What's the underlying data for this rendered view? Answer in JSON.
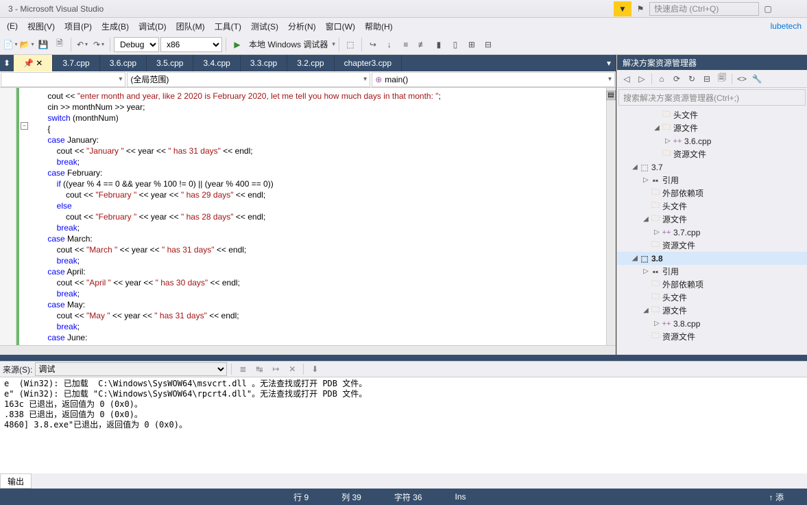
{
  "titlebar": {
    "title": "3 - Microsoft Visual Studio",
    "quicklaunch_placeholder": "快速启动 (Ctrl+Q)",
    "user": "lubetech"
  },
  "menu": {
    "items": [
      "(E)",
      "视图(V)",
      "项目(P)",
      "生成(B)",
      "调试(D)",
      "团队(M)",
      "工具(T)",
      "测试(S)",
      "分析(N)",
      "窗口(W)",
      "帮助(H)"
    ]
  },
  "toolbar": {
    "config": "Debug",
    "platform": "x86",
    "debugger": "本地 Windows 调试器"
  },
  "tabs": [
    {
      "label": "3.7.cpp",
      "active": false
    },
    {
      "label": "3.6.cpp",
      "active": false
    },
    {
      "label": "3.5.cpp",
      "active": false
    },
    {
      "label": "3.4.cpp",
      "active": false
    },
    {
      "label": "3.3.cpp",
      "active": false
    },
    {
      "label": "3.2.cpp",
      "active": false
    },
    {
      "label": "chapter3.cpp",
      "active": false
    }
  ],
  "activeTab": "",
  "navbar": {
    "scope": "(全局范围)",
    "func": "main()"
  },
  "code_lines": [
    {
      "indent": 1,
      "t": [
        {
          "k": "p",
          "v": "cout << "
        },
        {
          "k": "s",
          "v": "\"enter month and year, like 2 2020 is February 2020, let me tell you how much days in that month: \""
        },
        {
          "k": "p",
          "v": ";"
        }
      ]
    },
    {
      "indent": 1,
      "t": [
        {
          "k": "p",
          "v": "cin >> monthNum >> year;"
        }
      ]
    },
    {
      "indent": 1,
      "t": [
        {
          "k": "k",
          "v": "switch"
        },
        {
          "k": "p",
          "v": " (monthNum)"
        }
      ]
    },
    {
      "indent": 1,
      "t": [
        {
          "k": "p",
          "v": "{"
        }
      ]
    },
    {
      "indent": 1,
      "t": [
        {
          "k": "k",
          "v": "case"
        },
        {
          "k": "p",
          "v": " January:"
        }
      ]
    },
    {
      "indent": 2,
      "t": [
        {
          "k": "p",
          "v": "cout << "
        },
        {
          "k": "s",
          "v": "\"January \""
        },
        {
          "k": "p",
          "v": " << year << "
        },
        {
          "k": "s",
          "v": "\" has 31 days\""
        },
        {
          "k": "p",
          "v": " << endl;"
        }
      ]
    },
    {
      "indent": 2,
      "t": [
        {
          "k": "k",
          "v": "break"
        },
        {
          "k": "p",
          "v": ";"
        }
      ]
    },
    {
      "indent": 1,
      "t": [
        {
          "k": "k",
          "v": "case"
        },
        {
          "k": "p",
          "v": " February:"
        }
      ]
    },
    {
      "indent": 2,
      "t": [
        {
          "k": "k",
          "v": "if"
        },
        {
          "k": "p",
          "v": " ((year % 4 == 0 && year % 100 != 0) || (year % 400 == 0))"
        }
      ]
    },
    {
      "indent": 3,
      "t": [
        {
          "k": "p",
          "v": "cout << "
        },
        {
          "k": "s",
          "v": "\"February \""
        },
        {
          "k": "p",
          "v": " << year << "
        },
        {
          "k": "s",
          "v": "\" has 29 days\""
        },
        {
          "k": "p",
          "v": " << endl;"
        }
      ]
    },
    {
      "indent": 2,
      "t": [
        {
          "k": "k",
          "v": "else"
        }
      ]
    },
    {
      "indent": 3,
      "t": [
        {
          "k": "p",
          "v": "cout << "
        },
        {
          "k": "s",
          "v": "\"February \""
        },
        {
          "k": "p",
          "v": " << year << "
        },
        {
          "k": "s",
          "v": "\" has 28 days\""
        },
        {
          "k": "p",
          "v": " << endl;"
        }
      ]
    },
    {
      "indent": 2,
      "t": [
        {
          "k": "k",
          "v": "break"
        },
        {
          "k": "p",
          "v": ";"
        }
      ]
    },
    {
      "indent": 1,
      "t": [
        {
          "k": "k",
          "v": "case"
        },
        {
          "k": "p",
          "v": " March:"
        }
      ]
    },
    {
      "indent": 2,
      "t": [
        {
          "k": "p",
          "v": "cout << "
        },
        {
          "k": "s",
          "v": "\"March \""
        },
        {
          "k": "p",
          "v": " << year << "
        },
        {
          "k": "s",
          "v": "\" has 31 days\""
        },
        {
          "k": "p",
          "v": " << endl;"
        }
      ]
    },
    {
      "indent": 2,
      "t": [
        {
          "k": "k",
          "v": "break"
        },
        {
          "k": "p",
          "v": ";"
        }
      ]
    },
    {
      "indent": 1,
      "t": [
        {
          "k": "k",
          "v": "case"
        },
        {
          "k": "p",
          "v": " April:"
        }
      ]
    },
    {
      "indent": 2,
      "t": [
        {
          "k": "p",
          "v": "cout << "
        },
        {
          "k": "s",
          "v": "\"April \""
        },
        {
          "k": "p",
          "v": " << year << "
        },
        {
          "k": "s",
          "v": "\" has 30 days\""
        },
        {
          "k": "p",
          "v": " << endl;"
        }
      ]
    },
    {
      "indent": 2,
      "t": [
        {
          "k": "k",
          "v": "break"
        },
        {
          "k": "p",
          "v": ";"
        }
      ]
    },
    {
      "indent": 1,
      "t": [
        {
          "k": "k",
          "v": "case"
        },
        {
          "k": "p",
          "v": " May:"
        }
      ]
    },
    {
      "indent": 2,
      "t": [
        {
          "k": "p",
          "v": "cout << "
        },
        {
          "k": "s",
          "v": "\"May \""
        },
        {
          "k": "p",
          "v": " << year << "
        },
        {
          "k": "s",
          "v": "\" has 31 days\""
        },
        {
          "k": "p",
          "v": " << endl;"
        }
      ]
    },
    {
      "indent": 2,
      "t": [
        {
          "k": "k",
          "v": "break"
        },
        {
          "k": "p",
          "v": ";"
        }
      ]
    },
    {
      "indent": 1,
      "t": [
        {
          "k": "k",
          "v": "case"
        },
        {
          "k": "p",
          "v": " June:"
        }
      ]
    }
  ],
  "solution": {
    "header": "解决方案资源管理器",
    "search_placeholder": "搜索解决方案资源管理器(Ctrl+;)",
    "nodes": [
      {
        "depth": 3,
        "exp": "",
        "icon": "folder",
        "label": "头文件"
      },
      {
        "depth": 3,
        "exp": "◢",
        "icon": "folder",
        "label": "源文件"
      },
      {
        "depth": 4,
        "exp": "▷",
        "icon": "cpp",
        "label": "3.6.cpp"
      },
      {
        "depth": 3,
        "exp": "",
        "icon": "folder",
        "label": "资源文件"
      },
      {
        "depth": 1,
        "exp": "◢",
        "icon": "proj",
        "label": "3.7"
      },
      {
        "depth": 2,
        "exp": "▷",
        "icon": "ref",
        "label": "引用"
      },
      {
        "depth": 2,
        "exp": "",
        "icon": "folder",
        "label": "外部依赖项"
      },
      {
        "depth": 2,
        "exp": "",
        "icon": "folder",
        "label": "头文件"
      },
      {
        "depth": 2,
        "exp": "◢",
        "icon": "folder",
        "label": "源文件"
      },
      {
        "depth": 3,
        "exp": "▷",
        "icon": "cpp",
        "label": "3.7.cpp"
      },
      {
        "depth": 2,
        "exp": "",
        "icon": "folder",
        "label": "资源文件"
      },
      {
        "depth": 1,
        "exp": "◢",
        "icon": "proj",
        "label": "3.8",
        "bold": true,
        "sel": true
      },
      {
        "depth": 2,
        "exp": "▷",
        "icon": "ref",
        "label": "引用"
      },
      {
        "depth": 2,
        "exp": "",
        "icon": "folder",
        "label": "外部依赖项"
      },
      {
        "depth": 2,
        "exp": "",
        "icon": "folder",
        "label": "头文件"
      },
      {
        "depth": 2,
        "exp": "◢",
        "icon": "folder",
        "label": "源文件"
      },
      {
        "depth": 3,
        "exp": "▷",
        "icon": "cpp",
        "label": "3.8.cpp"
      },
      {
        "depth": 2,
        "exp": "",
        "icon": "folder",
        "label": "资源文件"
      }
    ]
  },
  "output": {
    "source_label": "来源(S):",
    "source_value": "调试",
    "lines": [
      "e\" (Win32): 已加载 \"C:\\Windows\\SysWOW64\\rpcrt4.dll\"。无法查找或打开 PDB 文件。",
      "163c 已退出，返回值为 0 (0x0)。",
      ".838 已退出，返回值为 0 (0x0)。",
      "4860] 3.8.exe\"已退出，返回值为 0 (0x0)。",
      ""
    ],
    "tab": "输出"
  },
  "status": {
    "line": "行 9",
    "col": "列 39",
    "char": "字符 36",
    "ins": "Ins",
    "add": "↑ 添"
  }
}
